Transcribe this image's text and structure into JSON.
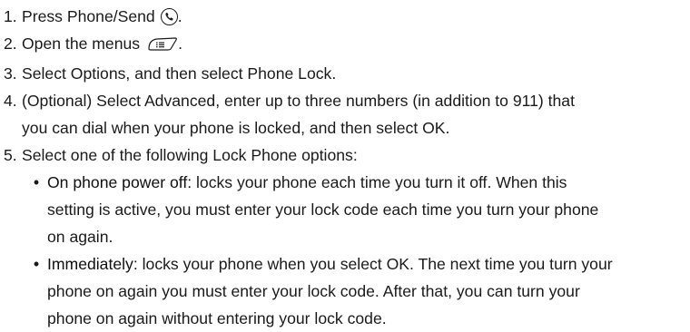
{
  "steps": [
    {
      "num": "1.",
      "text": "Press Phone/Send",
      "after_icon": ".",
      "icon": "phone-send-icon"
    },
    {
      "num": "2.",
      "text": "Open the menus",
      "after_icon": ".",
      "icon": "menu-key-icon"
    },
    {
      "num": "3.",
      "text": "Select Options, and then select Phone Lock."
    },
    {
      "num": "4.",
      "lines": [
        "(Optional) Select Advanced, enter up to three numbers (in addition to 911) that",
        "you can dial when your phone is locked, and then select OK."
      ]
    },
    {
      "num": "5.",
      "text": "Select one of the following Lock Phone options:"
    }
  ],
  "options": [
    {
      "term": "On phone power off:",
      "lines": [
        " locks your phone each time you turn it off. When this",
        "setting is active, you must enter your lock code each time you turn your phone",
        "on again."
      ]
    },
    {
      "term": "Immediately:",
      "lines": [
        " locks your phone when you select OK. The next time you turn your",
        "phone on again you must enter your lock code. After that, you can turn your",
        "phone on again without entering your lock code."
      ]
    }
  ],
  "bullet_glyph": "•"
}
